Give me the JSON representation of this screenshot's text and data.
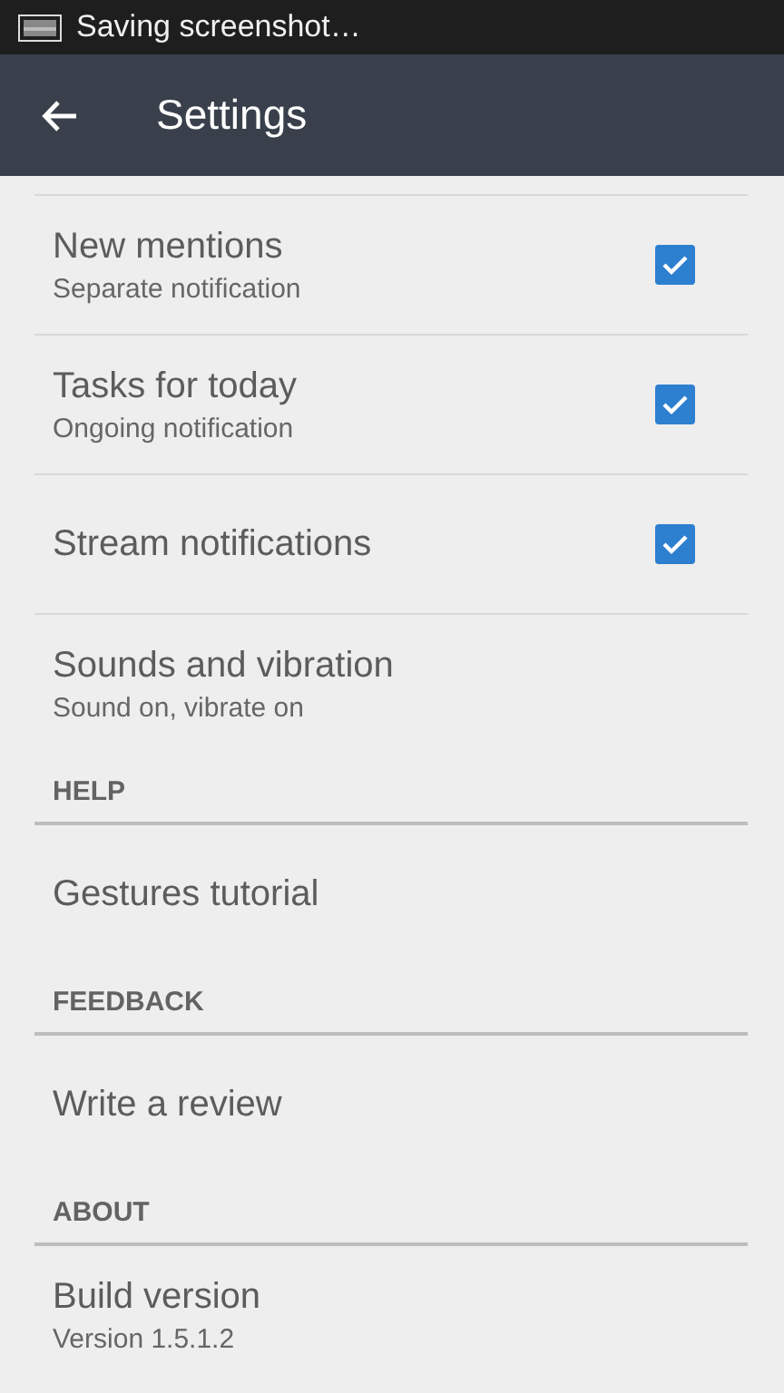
{
  "status_bar": {
    "notification": "Saving screenshot…"
  },
  "app_bar": {
    "title": "Settings"
  },
  "items": [
    {
      "kind": "setting",
      "title": "New mentions",
      "subtitle": "Separate notification",
      "checked": true
    },
    {
      "kind": "setting",
      "title": "Tasks for today",
      "subtitle": "Ongoing notification",
      "checked": true
    },
    {
      "kind": "setting",
      "title": "Stream notifications",
      "checked": true
    },
    {
      "kind": "setting",
      "title": "Sounds and vibration",
      "subtitle": "Sound on, vibrate on"
    },
    {
      "kind": "header",
      "title": "HELP"
    },
    {
      "kind": "setting",
      "title": "Gestures tutorial"
    },
    {
      "kind": "header",
      "title": "FEEDBACK"
    },
    {
      "kind": "setting",
      "title": "Write a review"
    },
    {
      "kind": "header",
      "title": "ABOUT"
    },
    {
      "kind": "setting",
      "title": "Build version",
      "subtitle": "Version 1.5.1.2"
    }
  ]
}
